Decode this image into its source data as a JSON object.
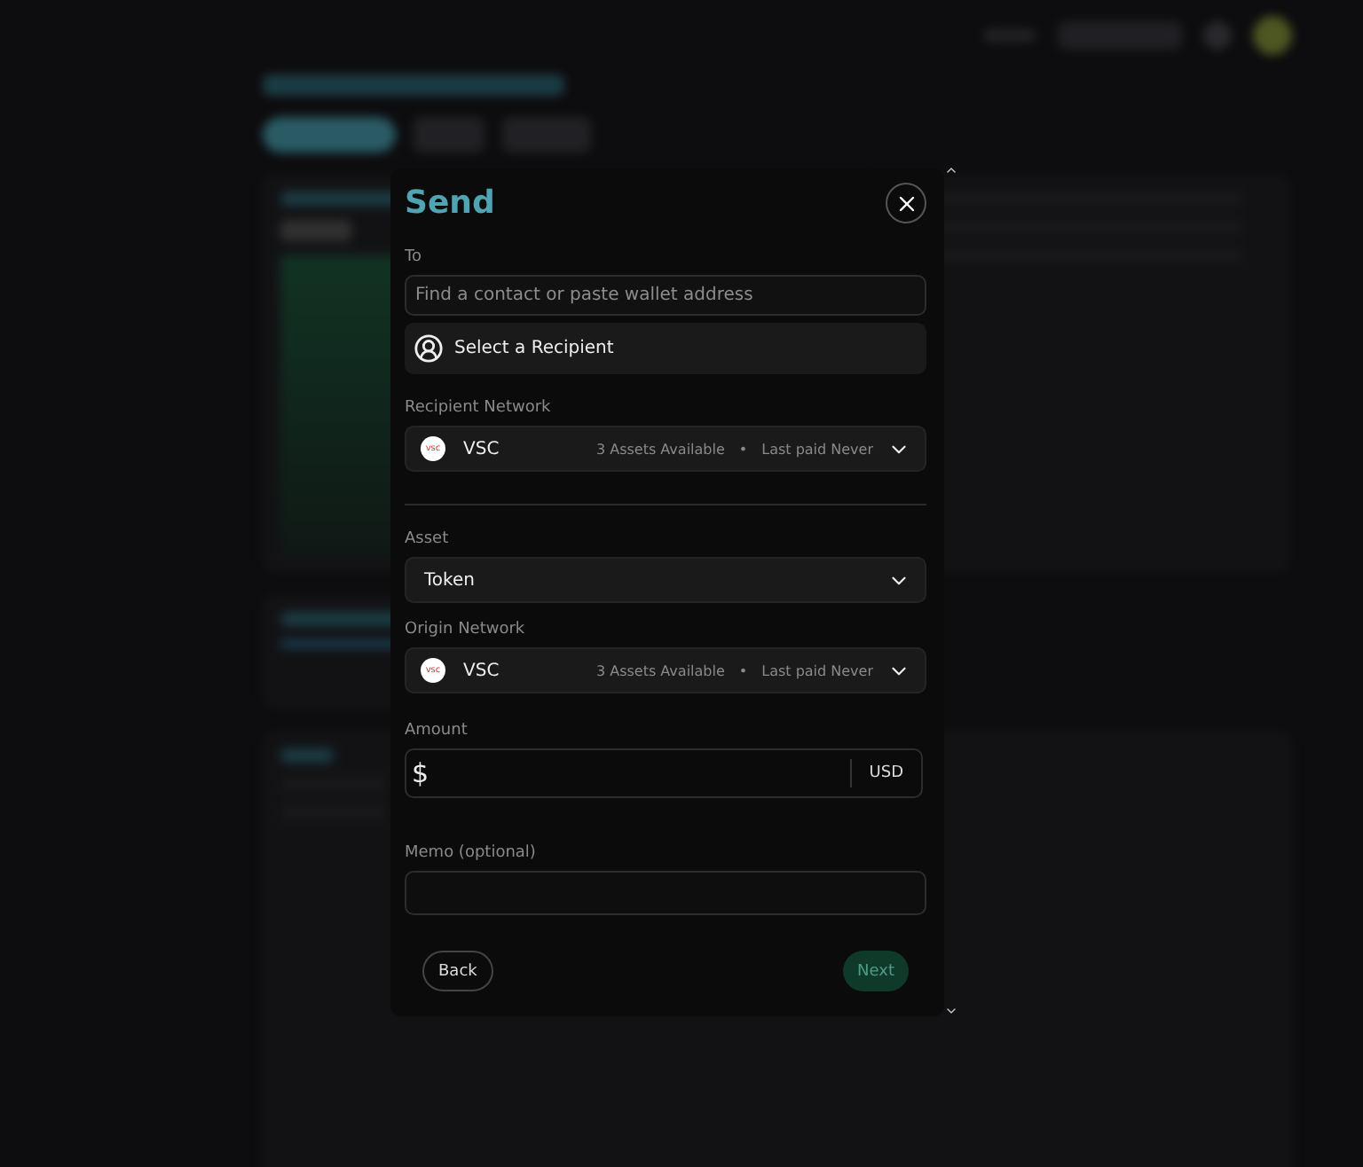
{
  "dialog": {
    "title": "Send",
    "to": {
      "label": "To",
      "placeholder": "Find a contact or paste wallet address"
    },
    "recipient_button": "Select a Recipient",
    "recipient_network": {
      "label": "Recipient Network",
      "logo_text": "vsc",
      "network": "VSC",
      "assets": "3 Assets Available",
      "separator": "•",
      "last_paid": "Last paid Never"
    },
    "asset": {
      "label": "Asset",
      "value": "Token"
    },
    "origin_network": {
      "label": "Origin Network",
      "logo_text": "vsc",
      "network": "VSC",
      "assets": "3 Assets Available",
      "separator": "•",
      "last_paid": "Last paid Never"
    },
    "amount": {
      "label": "Amount",
      "symbol": "$",
      "currency": "USD"
    },
    "memo": {
      "label": "Memo (optional)"
    },
    "back_button": "Back",
    "next_button": {
      "label": "Next",
      "disabled": true
    }
  }
}
